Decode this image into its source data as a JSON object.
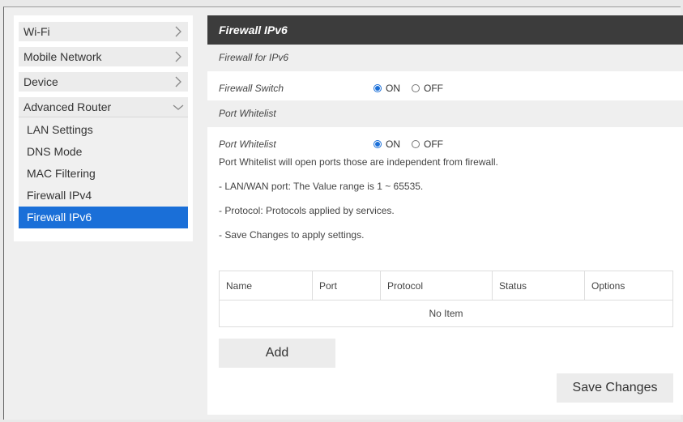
{
  "sidebar": {
    "items": [
      {
        "label": "Wi-Fi"
      },
      {
        "label": "Mobile Network"
      },
      {
        "label": "Device"
      },
      {
        "label": "Advanced Router"
      }
    ],
    "sub_items": [
      {
        "label": "LAN Settings"
      },
      {
        "label": "DNS Mode"
      },
      {
        "label": "MAC Filtering"
      },
      {
        "label": "Firewall IPv4"
      },
      {
        "label": "Firewall IPv6"
      }
    ],
    "active_sub_item": "Firewall IPv6"
  },
  "main": {
    "title": "Firewall IPv6",
    "section_firewall": "Firewall for IPv6",
    "firewall_switch": {
      "label": "Firewall Switch",
      "on_label": "ON",
      "off_label": "OFF",
      "selected": "ON"
    },
    "section_whitelist": "Port Whitelist",
    "port_whitelist": {
      "label": "Port Whitelist",
      "on_label": "ON",
      "off_label": "OFF",
      "selected": "ON"
    },
    "notes": [
      "Port Whitelist will open ports those are independent from firewall.",
      "- LAN/WAN port: The Value range is 1 ~ 65535.",
      "- Protocol: Protocols applied by services.",
      "- Save Changes to apply settings."
    ],
    "table": {
      "columns": [
        "Name",
        "Port",
        "Protocol",
        "Status",
        "Options"
      ],
      "empty_text": "No Item"
    },
    "add_label": "Add",
    "save_label": "Save Changes"
  },
  "colors": {
    "accent": "#1a6fd8",
    "header_bg": "#3c3c3c",
    "section_bg": "#efefef"
  },
  "icons": {
    "chevron_right": "chevron-right-icon",
    "chevron_down": "chevron-down-icon",
    "radio": "radio-icon"
  }
}
